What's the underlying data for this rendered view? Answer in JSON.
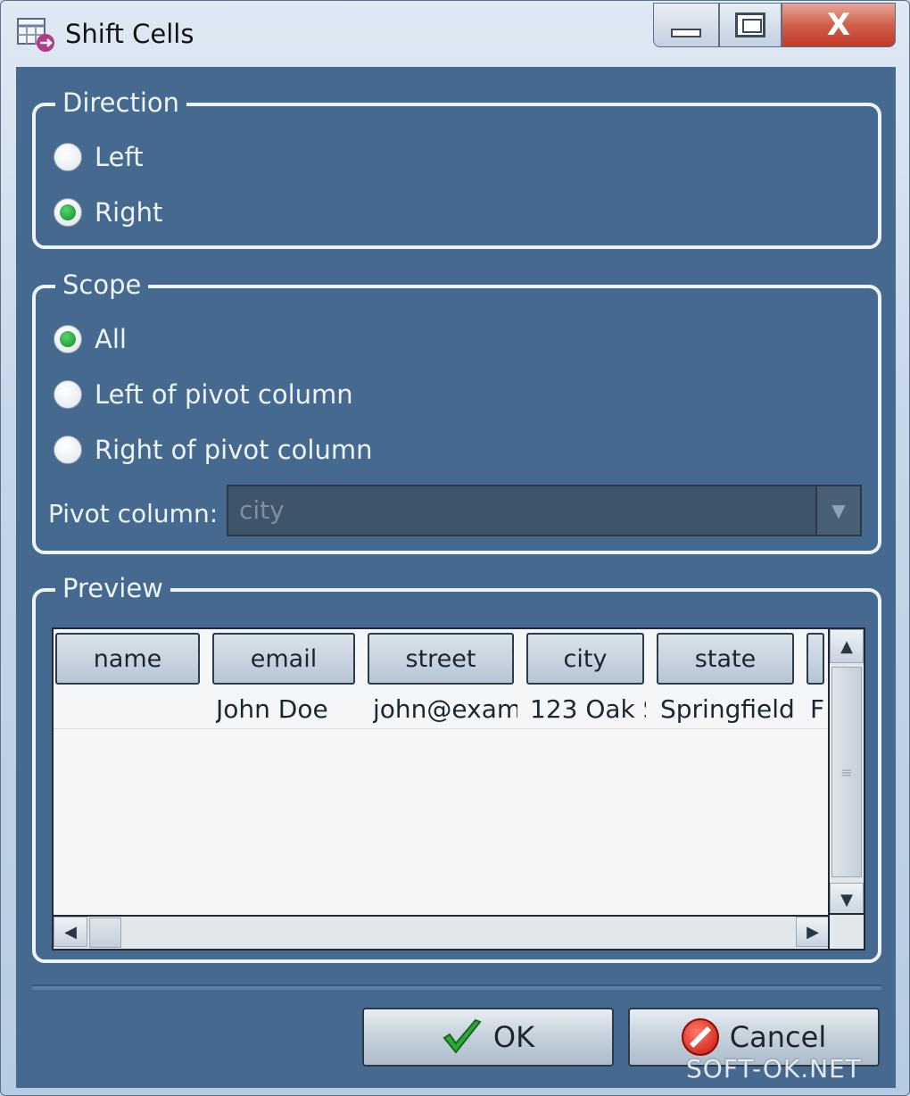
{
  "window": {
    "title": "Shift Cells",
    "controls": {
      "minimize": "—",
      "maximize": "□",
      "close": "X"
    }
  },
  "direction": {
    "legend": "Direction",
    "options": [
      {
        "label": "Left",
        "selected": false
      },
      {
        "label": "Right",
        "selected": true
      }
    ]
  },
  "scope": {
    "legend": "Scope",
    "options": [
      {
        "label": "All",
        "selected": true
      },
      {
        "label": "Left of pivot column",
        "selected": false
      },
      {
        "label": "Right of pivot column",
        "selected": false
      }
    ],
    "pivot_label": "Pivot column:",
    "pivot_value": "city",
    "pivot_enabled": false
  },
  "preview": {
    "legend": "Preview",
    "columns": [
      "name",
      "email",
      "street",
      "city",
      "state"
    ],
    "rows": [
      [
        "",
        "John Doe",
        "john@exam",
        "123 Oak S",
        "Springfield",
        "F"
      ]
    ]
  },
  "buttons": {
    "ok": "OK",
    "cancel": "Cancel"
  },
  "watermark": "SOFT-OK.NET",
  "colors": {
    "panel": "#466a8f",
    "radio_selected": "#1fa032",
    "cancel_icon": "#d81a10"
  }
}
